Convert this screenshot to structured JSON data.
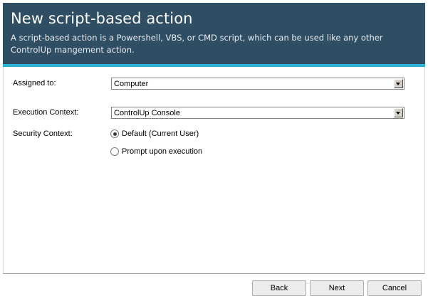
{
  "header": {
    "title": "New script-based action",
    "description": "A script-based action is a Powershell, VBS, or CMD script, which can be used like any other ControlUp mangement action."
  },
  "form": {
    "assigned_to": {
      "label": "Assigned to:",
      "value": "Computer"
    },
    "execution_context": {
      "label": "Execution Context:",
      "value": "ControlUp Console"
    },
    "security_context": {
      "label": "Security Context:",
      "options": [
        {
          "label": "Default (Current User)",
          "selected": true
        },
        {
          "label": "Prompt upon execution",
          "selected": false
        }
      ]
    }
  },
  "footer": {
    "back_label": "Back",
    "next_label": "Next",
    "cancel_label": "Cancel"
  },
  "colors": {
    "header_bg": "#2f4d63",
    "accent": "#29b3d3"
  }
}
